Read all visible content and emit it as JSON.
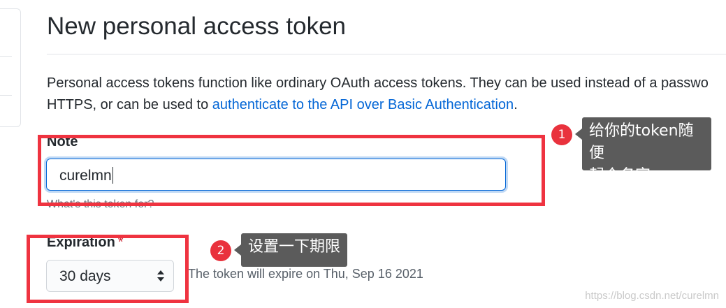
{
  "header": {
    "title": "New personal access token"
  },
  "description": {
    "line1": "Personal access tokens function like ordinary OAuth access tokens. They can be used instead of a passwo",
    "line2_prefix": "HTTPS, or can be used to ",
    "link": "authenticate to the API over Basic Authentication",
    "line2_suffix": "."
  },
  "note": {
    "label": "Note",
    "value": "curelmn",
    "hint": "What's this token for?"
  },
  "expiration": {
    "label": "Expiration",
    "required_mark": "*",
    "selected": "30 days",
    "info": "The token will expire on Thu, Sep 16 2021"
  },
  "annotations": {
    "callout1": {
      "number": "1",
      "line1": "给你的token随便",
      "line2": "起个名字"
    },
    "callout2": {
      "number": "2",
      "text": "设置一下期限"
    }
  },
  "watermark": "https://blog.csdn.net/curelmn",
  "colors": {
    "link": "#0366d6",
    "annotation_red": "#ef3340",
    "callout_bg": "#5b5b5b",
    "required": "#cb2431"
  }
}
